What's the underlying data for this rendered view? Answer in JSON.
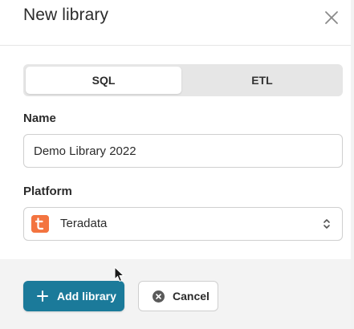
{
  "dialog": {
    "title": "New library",
    "close_icon": "close-icon"
  },
  "tabs": [
    {
      "label": "SQL",
      "selected": true
    },
    {
      "label": "ETL",
      "selected": false
    }
  ],
  "name_field": {
    "label": "Name",
    "value": "Demo Library 2022",
    "placeholder": ""
  },
  "platform_field": {
    "label": "Platform",
    "selected": "Teradata",
    "logo_icon": "teradata-logo-icon",
    "logo_color": "#f37440",
    "arrows_icon": "select-arrows-icon"
  },
  "footer": {
    "add_label": "Add library",
    "add_icon": "plus-icon",
    "cancel_label": "Cancel",
    "cancel_icon": "x-circle-icon"
  },
  "colors": {
    "primary": "#1b7a9a",
    "footer_bg": "#f3f3f3"
  }
}
